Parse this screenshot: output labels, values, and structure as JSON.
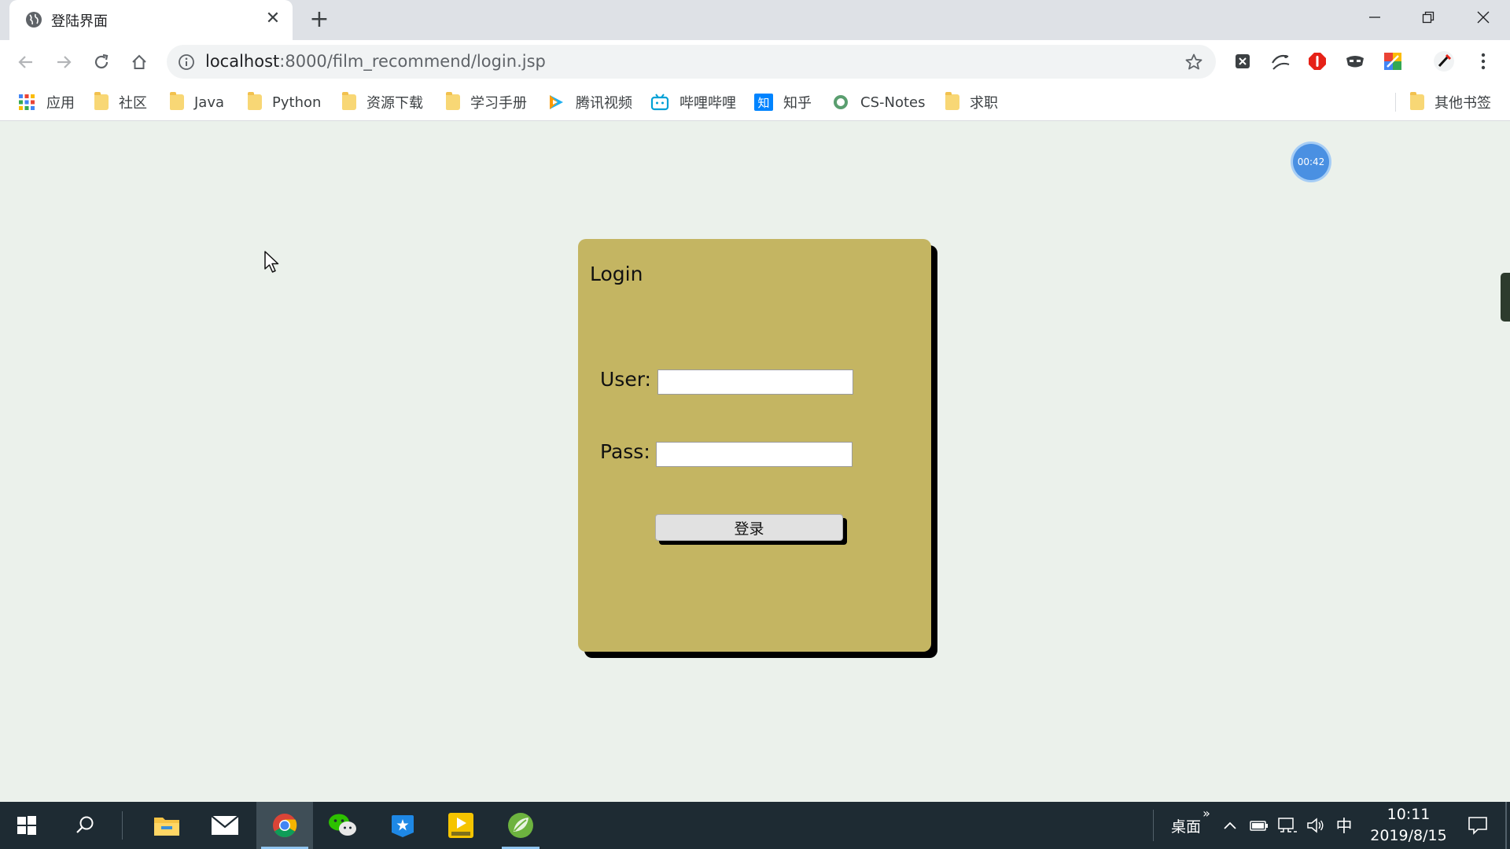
{
  "browser": {
    "tab_title": "登陆界面",
    "tab_close_glyph": "✕",
    "new_tab_glyph": "+",
    "url_host": "localhost",
    "url_path": ":8000/film_recommend/login.jsp"
  },
  "bookmarks": {
    "apps_label": "应用",
    "items": [
      "社区",
      "Java",
      "Python",
      "资源下载",
      "学习手册",
      "腾讯视频",
      "哔哩哔哩",
      "知乎",
      "CS-Notes",
      "求职"
    ],
    "other_label": "其他书签"
  },
  "page": {
    "timer_badge": "00:42",
    "login": {
      "title": "Login",
      "user_label": "User:",
      "pass_label": "Pass:",
      "user_value": "",
      "pass_value": "",
      "submit_label": "登录"
    }
  },
  "taskbar": {
    "desktop_label": "桌面",
    "toolbar_chevron": "»",
    "ime_label": "中",
    "time": "10:11",
    "date": "2019/8/15"
  },
  "colors": {
    "page_background": "#ebf1eb",
    "card_background": "#c4b562",
    "taskbar_background": "#1e2b33",
    "timer_badge": "#4a90e2"
  },
  "icons": {
    "tab_favicon": "globe-icon",
    "secure_info": "info-icon",
    "bookmark_star": "star-icon"
  }
}
